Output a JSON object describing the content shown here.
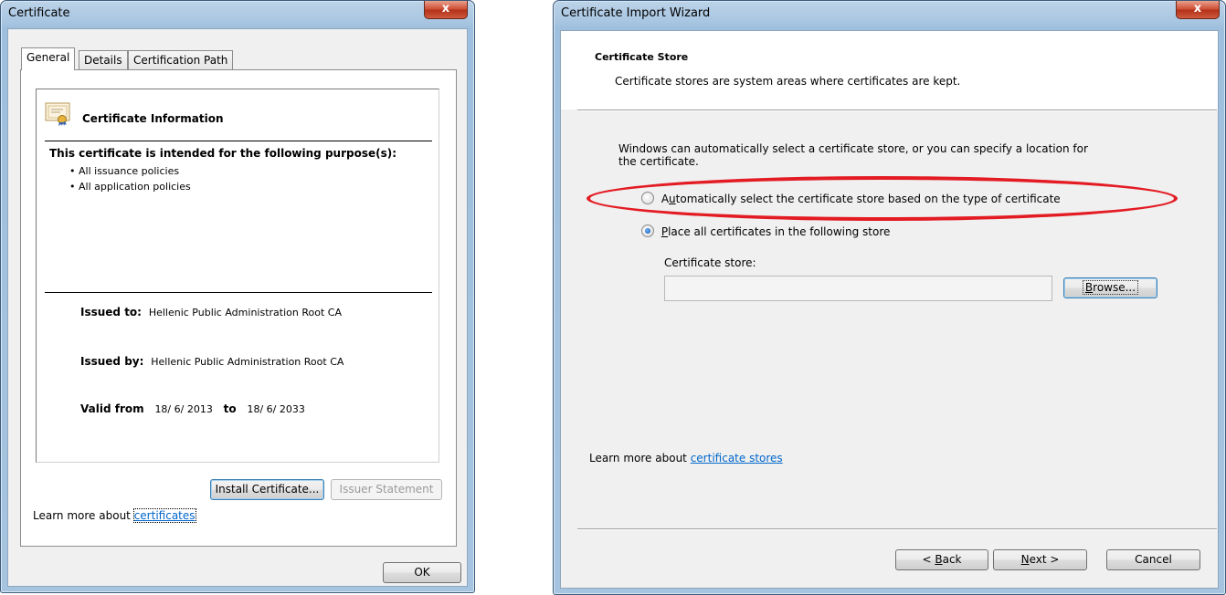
{
  "certificate_dialog": {
    "title": "Certificate",
    "close_label": "x",
    "tabs": [
      {
        "label": "General",
        "active": true
      },
      {
        "label": "Details",
        "active": false
      },
      {
        "label": "Certification Path",
        "active": false
      }
    ],
    "info_heading": "Certificate Information",
    "purpose_heading": "This certificate is intended for the following purpose(s):",
    "purposes": [
      "All issuance policies",
      "All application policies"
    ],
    "issued_to_label": "Issued to:",
    "issued_to_value": "Hellenic Public Administration Root CA",
    "issued_by_label": "Issued by:",
    "issued_by_value": "Hellenic Public Administration Root CA",
    "valid_from_label": "Valid from",
    "valid_from_value": "18/ 6/ 2013",
    "valid_to_label": "to",
    "valid_to_value": "18/ 6/ 2033",
    "install_button": "Install Certificate...",
    "issuer_statement_button": "Issuer Statement",
    "learn_more_prefix": "Learn more about",
    "learn_more_link": "certificates",
    "ok_button": "OK"
  },
  "import_wizard": {
    "title": "Certificate Import Wizard",
    "close_label": "x",
    "section_title": "Certificate Store",
    "section_desc": "Certificate stores are system areas where certificates are kept.",
    "intro_line1": "Windows can automatically select a certificate store, or you can specify a location for",
    "intro_line2": "the certificate.",
    "radio_auto": {
      "prefix": "",
      "accel": "u",
      "label_rest": "tomatically select the certificate store based on the type of certificate",
      "first": "A",
      "checked": false
    },
    "radio_place": {
      "accel": "P",
      "label_rest": "lace all certificates in the following store",
      "checked": true
    },
    "store_label": "Certificate store:",
    "store_value": "",
    "browse_accel": "B",
    "browse_rest": "rowse...",
    "learn_more_prefix": "Learn more about",
    "learn_more_link": "certificate stores",
    "back_prefix": "< ",
    "back_accel": "B",
    "back_rest": "ack",
    "next_accel": "N",
    "next_rest": "ext >",
    "cancel_button": "Cancel"
  },
  "colors": {
    "highlight_ellipse": "#e31b23",
    "link": "#0066cc"
  }
}
